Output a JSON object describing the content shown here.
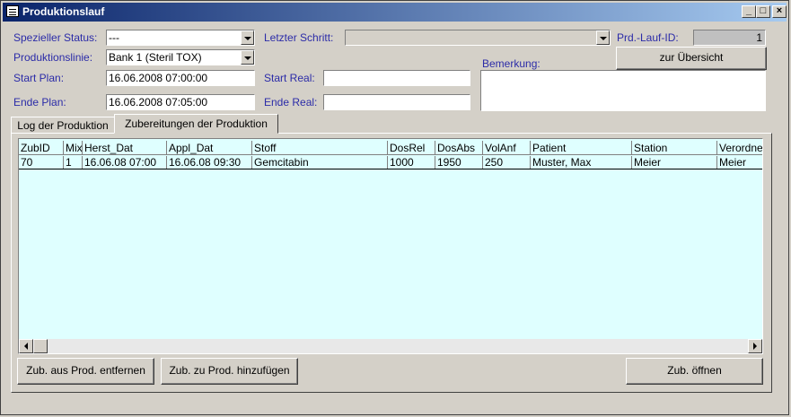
{
  "window": {
    "title": "Produktionslauf"
  },
  "form": {
    "spezieller_status_label": "Spezieller Status:",
    "spezieller_status_value": "---",
    "produktionslinie_label": "Produktionslinie:",
    "produktionslinie_value": "Bank 1 (Steril TOX)",
    "start_plan_label": "Start Plan:",
    "start_plan_value": "16.06.2008 07:00:00",
    "ende_plan_label": "Ende Plan:",
    "ende_plan_value": "16.06.2008 07:05:00",
    "letzter_schritt_label": "Letzter Schritt:",
    "letzter_schritt_value": "",
    "start_real_label": "Start Real:",
    "start_real_value": "",
    "ende_real_label": "Ende Real:",
    "ende_real_value": "",
    "prd_lauf_id_label": "Prd.-Lauf-ID:",
    "prd_lauf_id_value": "1",
    "bemerkung_label": "Bemerkung:",
    "bemerkung_value": "",
    "zur_uebersicht_button": "zur Übersicht"
  },
  "tabs": [
    {
      "label": "Log der Produktion",
      "active": false
    },
    {
      "label": "Zubereitungen der Produktion",
      "active": true
    }
  ],
  "grid": {
    "columns": [
      "ZubID",
      "Mix",
      "Herst_Dat",
      "Appl_Dat",
      "Stoff",
      "DosRel",
      "DosAbs",
      "VolAnf",
      "Patient",
      "Station",
      "Verordne"
    ],
    "rows": [
      [
        "70",
        "1",
        "16.06.08 07:00",
        "16.06.08 09:30",
        "Gemcitabin",
        "1000",
        "1950",
        "250",
        "Muster, Max",
        "Meier",
        "Meier"
      ]
    ]
  },
  "buttons": {
    "remove": "Zub. aus Prod. entfernen",
    "add": "Zub. zu Prod. hinzufügen",
    "open": "Zub. öffnen"
  }
}
